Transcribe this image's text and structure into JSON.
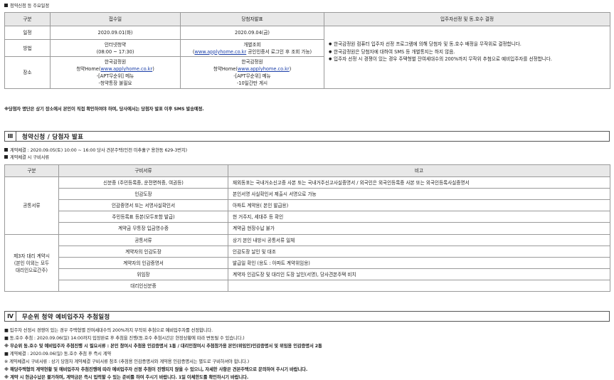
{
  "top_label": "청약신청 등 주요일정",
  "schedule": {
    "headers": [
      "구분",
      "접수일",
      "당첨자발표",
      "입주자선정 및 동.호수 결정"
    ],
    "rows": [
      {
        "label": "일정",
        "receipt": "2020.09.01(화)",
        "announce": "2020.09.04(금)"
      },
      {
        "label": "방법",
        "receipt_1": "인터넷청약",
        "receipt_2": "(08:00 ~ 17:30)",
        "announce_1": "개별조회",
        "announce_link": "www.applyhome.co.kr",
        "announce_2": " 공인인증서 로그인 후 조회 가능)",
        "announce_open": "("
      },
      {
        "label": "장소",
        "receipt_1": "한국감정원",
        "receipt_2a": "청약Home(",
        "receipt_link": "www.applyhome.co.kr",
        "receipt_2b": ")",
        "receipt_3": "-[APT무순위] 메뉴",
        "receipt_4": "-청약통장 불필요",
        "announce_1": "한국감정원",
        "announce_2a": "청약Home(",
        "announce_link": "www.applyhome.co.kr",
        "announce_2b": ")",
        "announce_3": "-[APT무순위] 메뉴",
        "announce_4": "-10일간만 게시"
      }
    ],
    "decision_notes": [
      "한국감정원 컴퓨터 입주자 선정 프로그램에 의해 당첨자 및 동.호수 배정을 무작위로 결정합니다.",
      "한국감정원은 당첨자에 대하여 SMS 등 개별통지는 하지 않음.",
      "입주자 선정 시 경쟁이 있는 경우 주택형별 잔여세대수의 200%까지 무작위 추첨으로 예비입주자를 선정합니다."
    ]
  },
  "schedule_footnote": "※당첨자 명단은 상기 장소에서 본인이 직접 확인하여야 하며, 당사에서는 당첨자 발표 이후 SMS 발송예정.",
  "section3": {
    "num": "Ⅲ",
    "title": "청약신청 / 당첨자 발표",
    "bullet1": "계약체결 : 2020.09.05(토) 10:00 ~ 16:00 당사 견본주택(인천 미추홀구 용현동 629-3번지)",
    "bullet2": "계약체결 시 구비서류",
    "headers": [
      "구분",
      "구비서류",
      "비고"
    ],
    "common_label": "공통서류",
    "common_rows": [
      {
        "doc": "신분증 (주민등록증, 운전면허증, 여권등)",
        "note": "재외동포는 국내거소신고증 사본 또는 국내거주신고사실증명서 / 외국인은 외국인등록증 사본 또는 외국인등록사실증명서"
      },
      {
        "doc": "인감도장",
        "note": "본인서명 사실확인서 제출시 서명으로 가능"
      },
      {
        "doc": "인감증명서 또는 서명사실확인서",
        "note": "아파트 계약용( 본인 발급용)"
      },
      {
        "doc": "주민등록표 등본(모두포함 발급)",
        "note": "현 거주지, 세대주 등 확인"
      },
      {
        "doc": "계약금 무통장 입금영수증",
        "note": "계약금 현장수납 불가"
      }
    ],
    "proxy_label_1": "제3자 대리 계약시",
    "proxy_label_2": "(본인 이외는 모두",
    "proxy_label_3": "대리인으로간주)",
    "proxy_rows": [
      {
        "doc": "공통서류",
        "note": "상기 본인 내방시 공통서류 일체"
      },
      {
        "doc": "계약자의 인감도장",
        "note": "인감도장 날인 및 대조"
      },
      {
        "doc": "계약자의 인감증명서",
        "note": "발급일 확인 (용도 : 아파트 계약위임용)"
      },
      {
        "doc": "위임장",
        "note": "계약자 인감도장 및 대리인 도장 날인(서명), 당사견본주택 비치"
      },
      {
        "doc": "대리인신분증",
        "note": ""
      }
    ]
  },
  "section4": {
    "num": "Ⅳ",
    "title": "무순위 청약 예비입주자 추첨일정",
    "lines": [
      {
        "text": "입주자 선정시 경쟁이 있는 경우 주택형별 잔여세대수의 200%까지 무작위 추첨으로 예비입주자를 선정합니다.",
        "mark": "■",
        "bold": false
      },
      {
        "text": "동.호수 추첨 : 2020.09.06(일) 14:00까지 입장완료 후 추첨을 진행(동.호수 추첨시간은 현장상황에 따라 변동될 수 있습니다.)",
        "mark": "■",
        "bold": false
      },
      {
        "text": "무순위 동.호수 및 예비입주자 추첨진행 시 필요서류 : 본인 참여시 추첨용 인감증명서 1통 / 대리인참여시 추첨참가용 본인(위임인)인감증명서 및 위임용 인감증명서 2통",
        "mark": "※",
        "bold": true
      },
      {
        "text": "계약체결 : 2020.09.06(일) 동.호수 추첨 후 즉시 계약",
        "mark": "■",
        "bold": false
      },
      {
        "text": "계약체결시 구비서류 : 상기 당첨자 계약체결 구비서류 참조 (추첨용 인감증명서와 계약용 인감증명서는 별도로 구비하셔야 합니다.)",
        "mark": "※",
        "bold": false
      },
      {
        "text": "해당주택형의 계약현황 및 예비입주자 추첨진행에 따라 예비입주자 선정 추첨이 진행되지 않을 수 있으니, 자세한 사항은 견본주택으로 문의하여 주시기 바랍니다.",
        "mark": "※",
        "bold": true
      },
      {
        "text": "계약 시 현금수납은 불가하며, 계약금은 즉시 입력할 수 있는 준비를 하여 주시기 바랍니다. 1일 이체한도를 확인하시기 바랍니다.",
        "mark": "※",
        "bold": true
      }
    ]
  }
}
